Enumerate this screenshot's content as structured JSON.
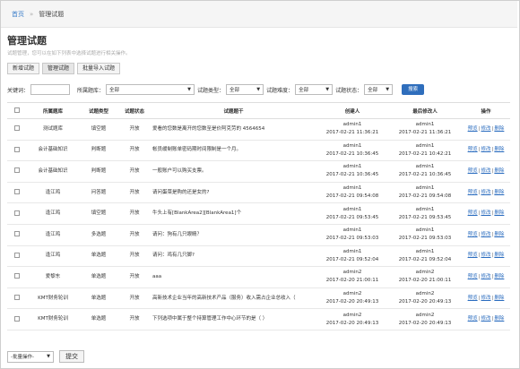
{
  "breadcrumb": {
    "home": "首页",
    "sep": "»",
    "current": "管理试题"
  },
  "page": {
    "title": "管理试题",
    "description": "试题管理，您可以在如下列表中选择试题进行相关操作。"
  },
  "tabs": [
    {
      "label": "新增试题"
    },
    {
      "label": "管理试题"
    },
    {
      "label": "批量导入试题"
    }
  ],
  "filter": {
    "keyword_label": "关键词：",
    "keyword_value": "",
    "bank_label": "所属题库：",
    "bank_value": "全部",
    "type_label": "试题类型：",
    "type_value": "全部",
    "difficulty_label": "试题难度：",
    "difficulty_value": "全部",
    "status_label": "试题状态：",
    "status_value": "全部",
    "search_label": "搜索"
  },
  "table": {
    "headers": [
      "所属题库",
      "试题类型",
      "试题状态",
      "试题题干",
      "创建人",
      "最后修改人",
      "操作"
    ],
    "op_labels": {
      "view": "预览",
      "edit": "修改",
      "delete": "删除"
    },
    "rows": [
      {
        "bank": "测试题库",
        "type": "填空题",
        "status": "开放",
        "title": "爱看的您数是离开的您数至是价阿克劳的 4564654",
        "creator": "admin1",
        "created": "2017-02-21 11:36:21",
        "modifier": "admin1",
        "modified": "2017-02-21 11:36:21"
      },
      {
        "bank": "会计基础知识",
        "type": "判断题",
        "status": "开放",
        "title": "帐员缓制账单密码期时间限制是一个月。",
        "creator": "admin1",
        "created": "2017-02-21 10:36:45",
        "modifier": "admin1",
        "modified": "2017-02-21 10:42:21"
      },
      {
        "bank": "会计基础知识",
        "type": "判断题",
        "status": "开放",
        "title": "一般账户可以购买支票。",
        "creator": "admin1",
        "created": "2017-02-21 10:36:45",
        "modifier": "admin1",
        "modified": "2017-02-21 10:36:45"
      },
      {
        "bank": "逢江鸡",
        "type": "问答题",
        "status": "开放",
        "title": "请问蛋菜是购的还是女的?",
        "creator": "admin1",
        "created": "2017-02-21 09:54:08",
        "modifier": "admin1",
        "modified": "2017-02-21 09:54:08"
      },
      {
        "bank": "逢江鸡",
        "type": "填空题",
        "status": "开放",
        "title": "牛头上有[BlankArea2][BlankArea1]个",
        "creator": "admin1",
        "created": "2017-02-21 09:53:45",
        "modifier": "admin1",
        "modified": "2017-02-21 09:53:45"
      },
      {
        "bank": "逢江鸡",
        "type": "多选题",
        "status": "开放",
        "title": "请问：狗有几只眼睛？",
        "creator": "admin1",
        "created": "2017-02-21 09:53:03",
        "modifier": "admin1",
        "modified": "2017-02-21 09:53:03"
      },
      {
        "bank": "逢江鸡",
        "type": "单选题",
        "status": "开放",
        "title": "请问：鸡有几只脚?",
        "creator": "admin1",
        "created": "2017-02-21 09:52:04",
        "modifier": "admin1",
        "modified": "2017-02-21 09:52:04"
      },
      {
        "bank": "爱黎东",
        "type": "单选题",
        "status": "开放",
        "title": "aaa",
        "creator": "admin2",
        "created": "2017-02-20 21:00:11",
        "modifier": "admin2",
        "modified": "2017-02-20 21:00:11"
      },
      {
        "bank": "KMT财务轮训",
        "type": "单选题",
        "status": "开放",
        "title": "高新技术企业当年的高新技术产品（服务）收入需占企业总收入（",
        "creator": "admin2",
        "created": "2017-02-20 20:49:13",
        "modifier": "admin2",
        "modified": "2017-02-20 20:49:13"
      },
      {
        "bank": "KMT财务轮训",
        "type": "单选题",
        "status": "开放",
        "title": "下列选项中属于整个持算管理工作中心环节的是（ ）",
        "creator": "admin2",
        "created": "2017-02-20 20:49:13",
        "modifier": "admin2",
        "modified": "2017-02-20 20:49:13"
      }
    ]
  },
  "bottom": {
    "batch_value": "-批量操作-",
    "submit_label": "提交"
  },
  "colors": {
    "accent": "#2f6ebc",
    "link": "#2a6cbf"
  }
}
